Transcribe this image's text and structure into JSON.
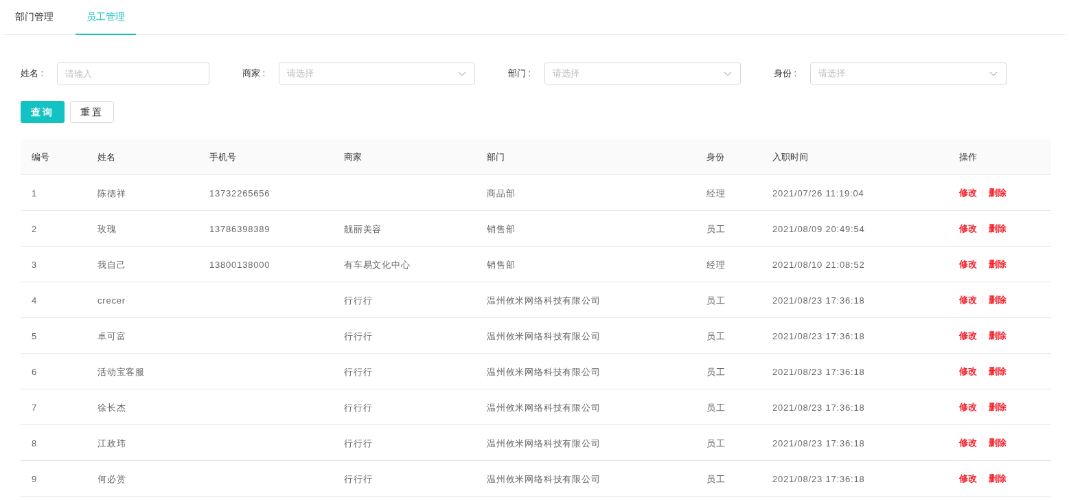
{
  "tabs": [
    {
      "label": "部门管理",
      "selected": false
    },
    {
      "label": "员工管理",
      "selected": true
    }
  ],
  "filters": [
    {
      "kind": "input",
      "label": "姓名 :",
      "placeholder": "请输入"
    },
    {
      "kind": "select",
      "label": "商家 :",
      "placeholder": "请选择"
    },
    {
      "kind": "select",
      "label": "部门 :",
      "placeholder": "请选择"
    },
    {
      "kind": "select",
      "label": "身份 :",
      "placeholder": "请选择"
    }
  ],
  "buttons": [
    {
      "kind": "primary",
      "label": "查询"
    },
    {
      "kind": "default",
      "label": "重置"
    }
  ],
  "table": {
    "columns": [
      "编号",
      "姓名",
      "手机号",
      "商家",
      "部门",
      "身份",
      "入职时间",
      "操作"
    ],
    "rows": [
      {
        "cells": [
          "1",
          "陈德祥",
          "13732265656",
          "",
          "商品部",
          "经理",
          "2021/07/26 11:19:04"
        ],
        "actions": [
          "修改",
          "删除"
        ]
      },
      {
        "cells": [
          "2",
          "玫瑰",
          "13786398389",
          "靓丽美容",
          "销售部",
          "员工",
          "2021/08/09 20:49:54"
        ],
        "actions": [
          "修改",
          "删除"
        ]
      },
      {
        "cells": [
          "3",
          "我自己",
          "13800138000",
          "有车易文化中心",
          "销售部",
          "经理",
          "2021/08/10 21:08:52"
        ],
        "actions": [
          "修改",
          "删除"
        ]
      },
      {
        "cells": [
          "4",
          "crecer",
          "",
          "行行行",
          "温州攸米网络科技有限公司",
          "员工",
          "2021/08/23 17:36:18"
        ],
        "actions": [
          "修改",
          "删除"
        ]
      },
      {
        "cells": [
          "5",
          "卓可富",
          "",
          "行行行",
          "温州攸米网络科技有限公司",
          "员工",
          "2021/08/23 17:36:18"
        ],
        "actions": [
          "修改",
          "删除"
        ]
      },
      {
        "cells": [
          "6",
          "活动宝客服",
          "",
          "行行行",
          "温州攸米网络科技有限公司",
          "员工",
          "2021/08/23 17:36:18"
        ],
        "actions": [
          "修改",
          "删除"
        ]
      },
      {
        "cells": [
          "7",
          "徐长杰",
          "",
          "行行行",
          "温州攸米网络科技有限公司",
          "员工",
          "2021/08/23 17:36:18"
        ],
        "actions": [
          "修改",
          "删除"
        ]
      },
      {
        "cells": [
          "8",
          "江政玮",
          "",
          "行行行",
          "温州攸米网络科技有限公司",
          "员工",
          "2021/08/23 17:36:18"
        ],
        "actions": [
          "修改",
          "删除"
        ]
      },
      {
        "cells": [
          "9",
          "何必赏",
          "",
          "行行行",
          "温州攸米网络科技有限公司",
          "员工",
          "2021/08/23 17:36:18"
        ],
        "actions": [
          "修改",
          "删除"
        ]
      }
    ]
  }
}
